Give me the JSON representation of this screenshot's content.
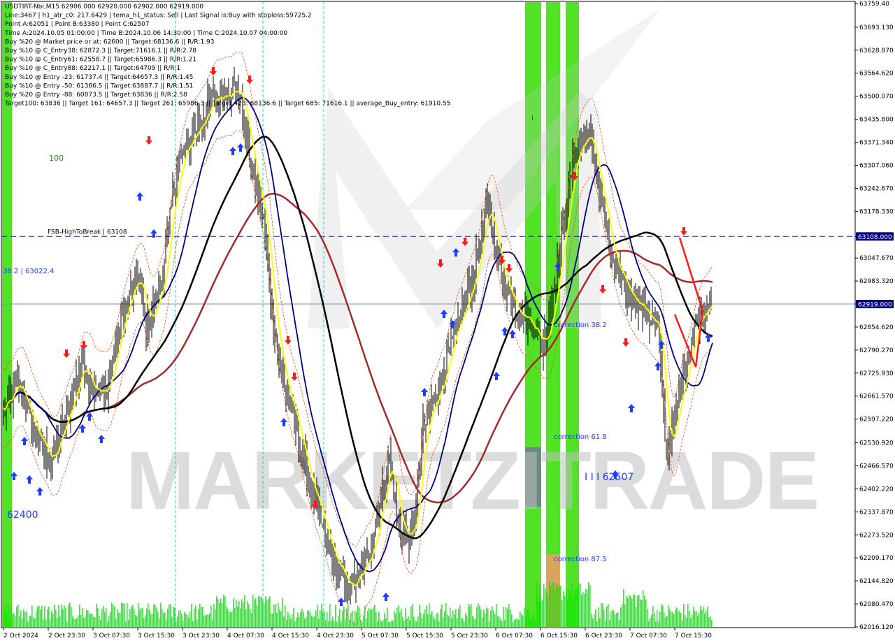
{
  "header": {
    "info_lines": [
      "USDTIRT-Nbi,M15  62906.000 62920.000 62902.000 62919.000",
      "Line:3467  |  h1_atr_c0: 217.6429  |  tema_h1_status: Sell  |  Last Signal is:Buy with stoploss:59725.2",
      "Point A:62051  |  Point B:63380  |  Point C:62507",
      "Time A:2024.10.05 01:00:00  |  Time B:2024.10.06 14:30:00  |  Time C:2024.10.07 04:00:00",
      "Buy %20 @ Market price or at: 62600  ||  Target:68136.6  ||  R/R:1.93",
      "Buy %10 @ C_Entry38: 62872.3  ||  Target:71616.1  ||  R/R:2.78",
      "Buy %10 @ C_Entry61: 62558.7  ||  Target:65986.3  ||  R/R:1.21",
      "Buy %10 @ C_Entry88: 62217.1  ||  Target:64709  ||  R/R:1",
      "Buy %10 @ Entry -23: 61737.4  ||  Target:64657.3  ||  R/R:1.45",
      "Buy %10 @ Entry -50: 61386.5  ||  Target:63887.7  ||  R/R:1.51",
      "Buy %20 @ Entry -88: 60873.5  ||  Target:63836  ||  R/R:2.58",
      "Target100: 63836  ||  Target 161: 64657.3  ||  Target 261: 65986.3  ||  Target 423: 68136.6  ||  Target 685: 71616.1  ||  average_Buy_entry: 61910.55"
    ]
  },
  "chart_data": {
    "type": "candlestick",
    "symbol": "USDTIRT-Nbi",
    "timeframe": "M15",
    "ohlc_current": {
      "open": 62906.0,
      "high": 62920.0,
      "low": 62902.0,
      "close": 62919.0
    },
    "y_axis": {
      "min": 62016.12,
      "max": 63759.4,
      "ticks": [
        "63759.40",
        "63693.130",
        "63628.870",
        "63564.620",
        "63500.070",
        "63435.800",
        "63371.340",
        "63307.060",
        "63242.670",
        "63178.330",
        "63108.000",
        "63047.670",
        "62983.320",
        "62919.000",
        "62854.620",
        "62790.270",
        "62725.930",
        "62661.570",
        "62597.220",
        "62530.920",
        "62466.570",
        "62402.220",
        "62337.870",
        "62273.520",
        "62209.170",
        "62144.820",
        "62080.470",
        "62016.120"
      ],
      "tick_values": [
        63759.4,
        63693.13,
        63628.87,
        63564.62,
        63500.07,
        63435.8,
        63371.34,
        63307.06,
        63242.67,
        63178.33,
        63108.0,
        63047.67,
        62983.32,
        62919.0,
        62854.62,
        62790.27,
        62725.93,
        62661.57,
        62597.22,
        62530.92,
        62466.57,
        62402.22,
        62337.87,
        62273.52,
        62209.17,
        62144.82,
        62080.47,
        62016.12
      ]
    },
    "x_axis": {
      "ticks": [
        "2 Oct 2024",
        "2 Oct 23:30",
        "3 Oct 07:30",
        "3 Oct 15:30",
        "3 Oct 23:30",
        "4 Oct 07:30",
        "4 Oct 15:30",
        "4 Oct 23:30",
        "5 Oct 07:30",
        "5 Oct 15:30",
        "5 Oct 23:30",
        "6 Oct 07:30",
        "6 Oct 15:30",
        "6 Oct 23:30",
        "7 Oct 07:30",
        "7 Oct 15:30"
      ],
      "bars_per_tick": 32
    },
    "levels": [
      {
        "label": "FSB-HighToBreak | 63108",
        "value": 63108.0,
        "tag": "63108.000",
        "color": "#1f1faa"
      },
      {
        "label": "",
        "value": 62919.0,
        "tag": "62919.000",
        "color": "#7f8ea0"
      }
    ],
    "annotations": {
      "fib_382": "38.2 | 63022.4",
      "level_100": "100",
      "price_62400": "62400",
      "correction_382": "correction 38.2",
      "correction_618": "correction 61.8",
      "correction_875": "correction 87.5",
      "point_c": "I I I 62507",
      "wave_i": "I"
    },
    "watermark": "MARKETZITRADE",
    "colors": {
      "bull": "#000000",
      "bear": "#000000",
      "yellow_ma": "#ffff00",
      "navy_ma": "#000080",
      "black_ma": "#000000",
      "darkred_ma": "#a52a2a",
      "envelope": "#ff4400",
      "buy_arrow": "#1f3cff",
      "sell_arrow": "#ff1a1a",
      "volume": "#00ee00",
      "green_band": "#33dd00",
      "level_line": "#1f1faa",
      "tag_bg": "#000080"
    },
    "path_points": [
      [
        0,
        62620
      ],
      [
        10,
        62700
      ],
      [
        22,
        62560
      ],
      [
        34,
        62480
      ],
      [
        46,
        62620
      ],
      [
        56,
        62760
      ],
      [
        62,
        62700
      ],
      [
        72,
        62660
      ],
      [
        86,
        62900
      ],
      [
        96,
        63000
      ],
      [
        102,
        62860
      ],
      [
        112,
        62960
      ],
      [
        124,
        63300
      ],
      [
        136,
        63400
      ],
      [
        148,
        63480
      ],
      [
        160,
        63520
      ],
      [
        168,
        63520
      ],
      [
        178,
        63300
      ],
      [
        186,
        63150
      ],
      [
        192,
        62900
      ],
      [
        200,
        62700
      ],
      [
        210,
        62560
      ],
      [
        220,
        62400
      ],
      [
        232,
        62240
      ],
      [
        246,
        62120
      ],
      [
        258,
        62180
      ],
      [
        266,
        62300
      ],
      [
        276,
        62500
      ],
      [
        282,
        62300
      ],
      [
        292,
        62260
      ],
      [
        300,
        62560
      ],
      [
        310,
        62680
      ],
      [
        320,
        62800
      ],
      [
        336,
        63000
      ],
      [
        346,
        63200
      ],
      [
        356,
        63000
      ],
      [
        368,
        62900
      ],
      [
        378,
        62860
      ],
      [
        386,
        62800
      ],
      [
        396,
        63020
      ],
      [
        408,
        63340
      ],
      [
        418,
        63400
      ],
      [
        428,
        63200
      ],
      [
        436,
        63020
      ],
      [
        448,
        62950
      ],
      [
        458,
        62900
      ],
      [
        468,
        62850
      ],
      [
        474,
        62500
      ],
      [
        480,
        62600
      ],
      [
        486,
        62720
      ],
      [
        494,
        62860
      ],
      [
        502,
        62920
      ],
      [
        512,
        63000
      ],
      [
        516,
        62919
      ]
    ]
  },
  "toolbar": {}
}
